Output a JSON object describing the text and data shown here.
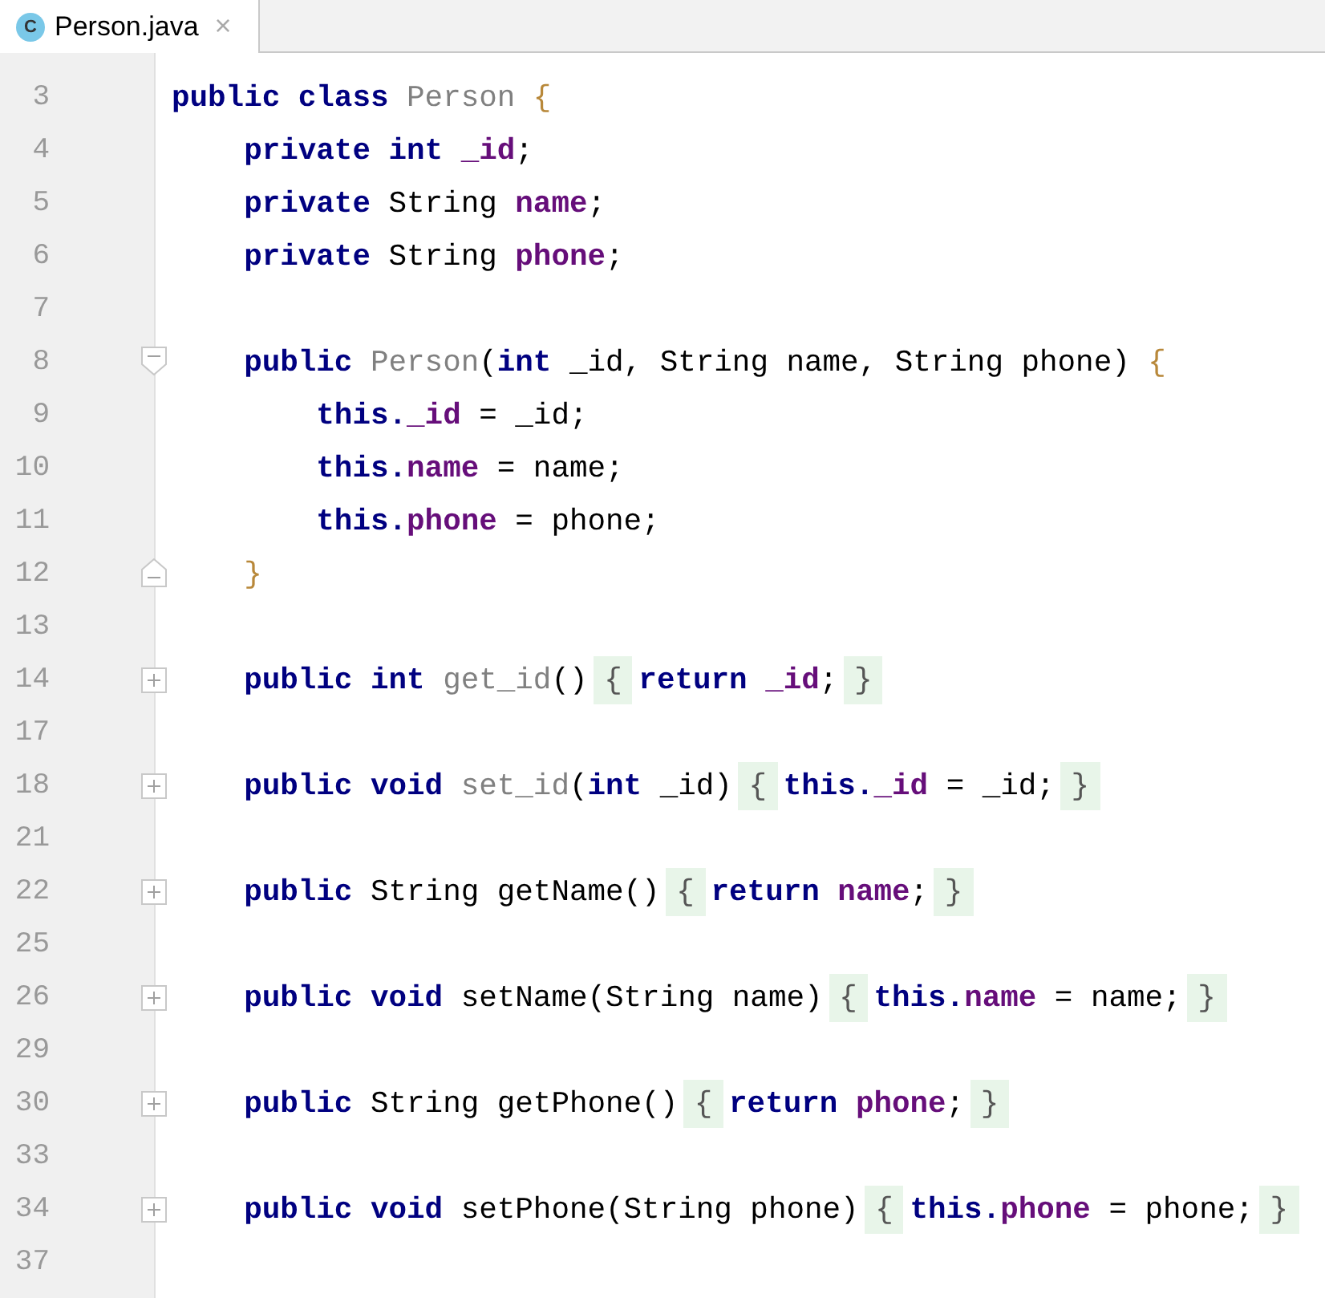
{
  "tabs": [
    {
      "label": "Person.java",
      "icon_text": "C",
      "close": "×",
      "selected": true
    }
  ],
  "editor": {
    "lines": [
      {
        "number": "3",
        "tokens": [
          {
            "text": "public class ",
            "kind": "keyword"
          },
          {
            "text": "Person",
            "kind": "unused"
          },
          {
            "text": " {",
            "kind": "brace"
          }
        ]
      },
      {
        "number": "4",
        "tokens": [
          {
            "text": "    private int ",
            "kind": "keyword"
          },
          {
            "text": "_id",
            "kind": "field"
          },
          {
            "text": ";",
            "kind": "plain"
          }
        ]
      },
      {
        "number": "5",
        "tokens": [
          {
            "text": "    private ",
            "kind": "keyword"
          },
          {
            "text": "String ",
            "kind": "plain"
          },
          {
            "text": "name",
            "kind": "field"
          },
          {
            "text": ";",
            "kind": "plain"
          }
        ]
      },
      {
        "number": "6",
        "tokens": [
          {
            "text": "    private ",
            "kind": "keyword"
          },
          {
            "text": "String ",
            "kind": "plain"
          },
          {
            "text": "phone",
            "kind": "field"
          },
          {
            "text": ";",
            "kind": "plain"
          }
        ]
      },
      {
        "number": "7"
      },
      {
        "number": "8",
        "fold": {
          "kind": "start"
        },
        "tokens": [
          {
            "text": "    public ",
            "kind": "keyword"
          },
          {
            "text": "Person",
            "kind": "unused"
          },
          {
            "text": "(",
            "kind": "plain"
          },
          {
            "text": "int ",
            "kind": "keyword"
          },
          {
            "text": "_id, String name, String phone)",
            "kind": "plain"
          },
          {
            "text": " {",
            "kind": "brace"
          }
        ]
      },
      {
        "number": "9",
        "tokens": [
          {
            "text": "        this.",
            "kind": "keyword"
          },
          {
            "text": "_id",
            "kind": "field"
          },
          {
            "text": " = _id;",
            "kind": "plain"
          }
        ]
      },
      {
        "number": "10",
        "tokens": [
          {
            "text": "        this.",
            "kind": "keyword"
          },
          {
            "text": "name",
            "kind": "field"
          },
          {
            "text": " = name;",
            "kind": "plain"
          }
        ]
      },
      {
        "number": "11",
        "tokens": [
          {
            "text": "        this.",
            "kind": "keyword"
          },
          {
            "text": "phone",
            "kind": "field"
          },
          {
            "text": " = phone;",
            "kind": "plain"
          }
        ]
      },
      {
        "number": "12",
        "fold": {
          "kind": "end"
        },
        "tokens": [
          {
            "text": "    }",
            "kind": "brace"
          }
        ]
      },
      {
        "number": "13"
      },
      {
        "number": "14",
        "fold": {
          "kind": "collapsed"
        },
        "tokens": [
          {
            "text": "    public int ",
            "kind": "keyword"
          },
          {
            "text": "get_id",
            "kind": "unused"
          },
          {
            "text": "()",
            "kind": "plain"
          },
          {
            "text": "{",
            "kind": "folded"
          },
          {
            "text": "return ",
            "kind": "keyword"
          },
          {
            "text": "_id",
            "kind": "field"
          },
          {
            "text": ";",
            "kind": "plain"
          },
          {
            "text": "}",
            "kind": "folded"
          }
        ]
      },
      {
        "number": "17"
      },
      {
        "number": "18",
        "fold": {
          "kind": "collapsed"
        },
        "tokens": [
          {
            "text": "    public void ",
            "kind": "keyword"
          },
          {
            "text": "set_id",
            "kind": "unused"
          },
          {
            "text": "(",
            "kind": "plain"
          },
          {
            "text": "int ",
            "kind": "keyword"
          },
          {
            "text": "_id)",
            "kind": "plain"
          },
          {
            "text": "{",
            "kind": "folded"
          },
          {
            "text": "this.",
            "kind": "keyword"
          },
          {
            "text": "_id",
            "kind": "field"
          },
          {
            "text": " = _id;",
            "kind": "plain"
          },
          {
            "text": "}",
            "kind": "folded"
          }
        ]
      },
      {
        "number": "21"
      },
      {
        "number": "22",
        "fold": {
          "kind": "collapsed"
        },
        "tokens": [
          {
            "text": "    public ",
            "kind": "keyword"
          },
          {
            "text": "String getName()",
            "kind": "plain"
          },
          {
            "text": "{",
            "kind": "folded"
          },
          {
            "text": "return ",
            "kind": "keyword"
          },
          {
            "text": "name",
            "kind": "field"
          },
          {
            "text": ";",
            "kind": "plain"
          },
          {
            "text": "}",
            "kind": "folded"
          }
        ]
      },
      {
        "number": "25"
      },
      {
        "number": "26",
        "fold": {
          "kind": "collapsed"
        },
        "tokens": [
          {
            "text": "    public void ",
            "kind": "keyword"
          },
          {
            "text": "setName(String name)",
            "kind": "plain"
          },
          {
            "text": "{",
            "kind": "folded"
          },
          {
            "text": "this.",
            "kind": "keyword"
          },
          {
            "text": "name",
            "kind": "field"
          },
          {
            "text": " = name;",
            "kind": "plain"
          },
          {
            "text": "}",
            "kind": "folded"
          }
        ]
      },
      {
        "number": "29"
      },
      {
        "number": "30",
        "fold": {
          "kind": "collapsed"
        },
        "tokens": [
          {
            "text": "    public ",
            "kind": "keyword"
          },
          {
            "text": "String getPhone()",
            "kind": "plain"
          },
          {
            "text": "{",
            "kind": "folded"
          },
          {
            "text": "return ",
            "kind": "keyword"
          },
          {
            "text": "phone",
            "kind": "field"
          },
          {
            "text": ";",
            "kind": "plain"
          },
          {
            "text": "}",
            "kind": "folded"
          }
        ]
      },
      {
        "number": "33"
      },
      {
        "number": "34",
        "fold": {
          "kind": "collapsed"
        },
        "tokens": [
          {
            "text": "    public void ",
            "kind": "keyword"
          },
          {
            "text": "setPhone(String phone)",
            "kind": "plain"
          },
          {
            "text": "{",
            "kind": "folded"
          },
          {
            "text": "this.",
            "kind": "keyword"
          },
          {
            "text": "phone",
            "kind": "field"
          },
          {
            "text": " = phone;",
            "kind": "plain"
          },
          {
            "text": "}",
            "kind": "folded"
          }
        ]
      },
      {
        "number": "37"
      }
    ]
  }
}
